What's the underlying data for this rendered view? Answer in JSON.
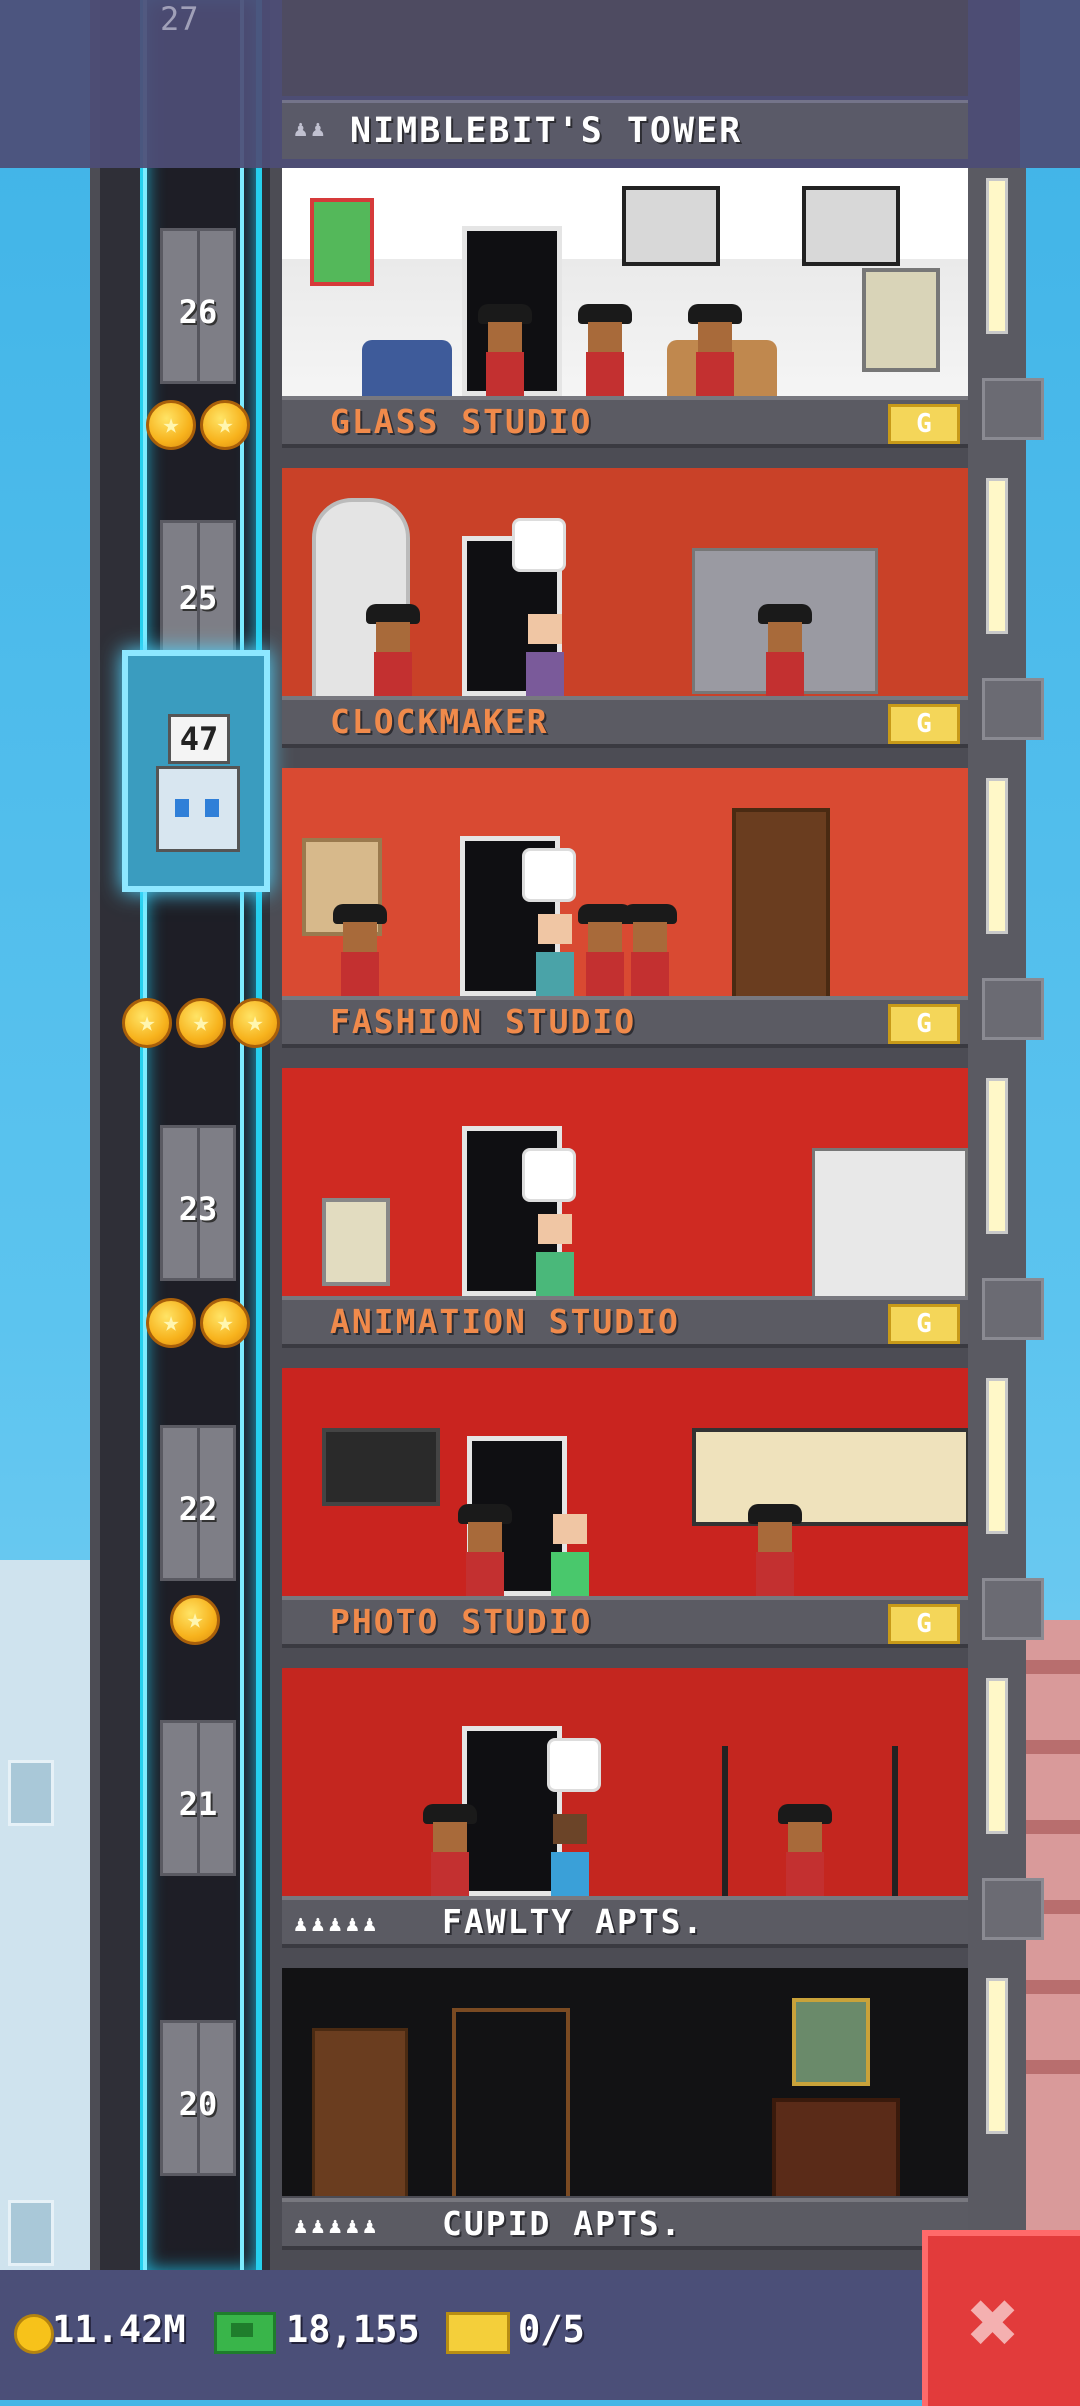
{
  "header": {
    "ghost_floor": "27",
    "tower_name": "NIMBLEBIT'S TOWER",
    "tower_icons": "♟♟"
  },
  "elevator": {
    "number": "47",
    "icon": "bitizen-elevator-operator-icon"
  },
  "floor_numbers": [
    "26",
    "25",
    "23",
    "22",
    "21",
    "20"
  ],
  "star_rows": [
    {
      "count": 2
    },
    {
      "count": 3
    },
    {
      "count": 2
    },
    {
      "count": 1
    }
  ],
  "floors": [
    {
      "label": "GLASS STUDIO",
      "badge": "G",
      "type": "business"
    },
    {
      "label": "CLOCKMAKER",
      "badge": "G",
      "type": "business"
    },
    {
      "label": "FASHION STUDIO",
      "badge": "G",
      "type": "business"
    },
    {
      "label": "ANIMATION STUDIO",
      "badge": "G",
      "type": "business"
    },
    {
      "label": "PHOTO STUDIO",
      "badge": "G",
      "type": "business"
    },
    {
      "label": "FAWLTY APTS.",
      "dots": "♟♟♟♟♟",
      "type": "residential"
    },
    {
      "label": "CUPID APTS.",
      "dots": "♟♟♟♟♟",
      "type": "residential"
    }
  ],
  "status_bar": {
    "coins": "11.42M",
    "bux": "18,155",
    "tickets": "0/5",
    "coin_icon": "gold-coin-icon",
    "bux_icon": "green-bux-icon",
    "ticket_icon": "golden-ticket-icon",
    "close_glyph": "✖"
  },
  "colors": {
    "sky": "#45b6e6",
    "shaft_glow": "#26d0ee",
    "label_orange": "#f08a4b",
    "badge_gold": "#f4d659",
    "close_red": "#e23b3b"
  }
}
